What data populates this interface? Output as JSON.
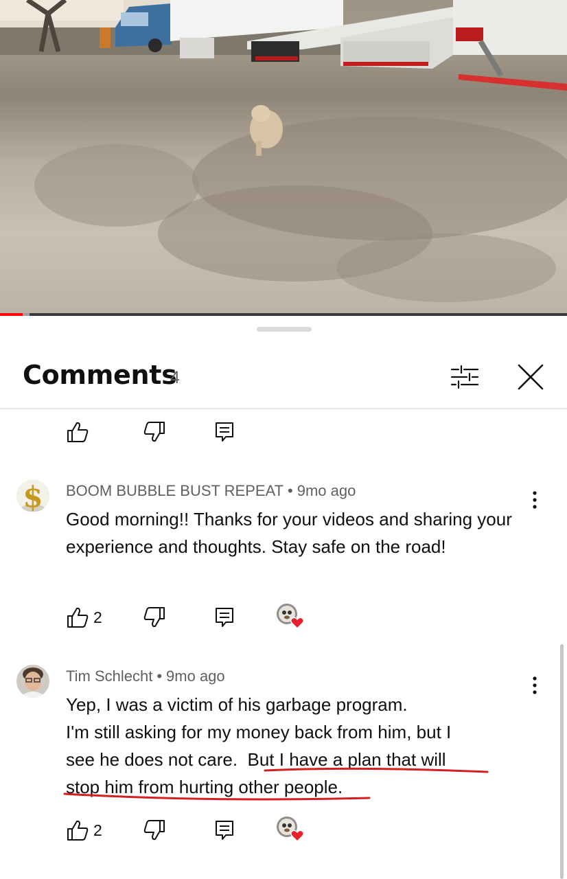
{
  "video": {
    "progress_percent": 4
  },
  "comments_sheet": {
    "title": "Comments",
    "count": "4"
  },
  "icons": {
    "filter": "sliders-icon",
    "close": "close-icon",
    "like": "thumbs-up-icon",
    "dislike": "thumbs-down-icon",
    "reply": "reply-icon",
    "more": "more-vertical-icon",
    "creator_heart": "creator-heart-badge"
  },
  "colors": {
    "progress": "#ff0000",
    "heart": "#e8202a",
    "annotation_underline": "#d21f1f",
    "secondary_text": "#606060"
  },
  "comments": [
    {
      "author": "BOOM BUBBLE BUST REPEAT",
      "time": "9mo ago",
      "text": "Good morning!! Thanks for your videos and sharing your experience and thoughts. Stay safe on the road!",
      "likes": "2",
      "hearted": true
    },
    {
      "author": "Tim Schlecht",
      "time": "9mo ago",
      "lines": [
        "Yep, I was a victim of his garbage program.",
        "I'm still asking for my money back from him, but I",
        "see he does not care.  But I have a plan that will",
        "stop him from hurting other people."
      ],
      "likes": "2",
      "hearted": true
    }
  ]
}
